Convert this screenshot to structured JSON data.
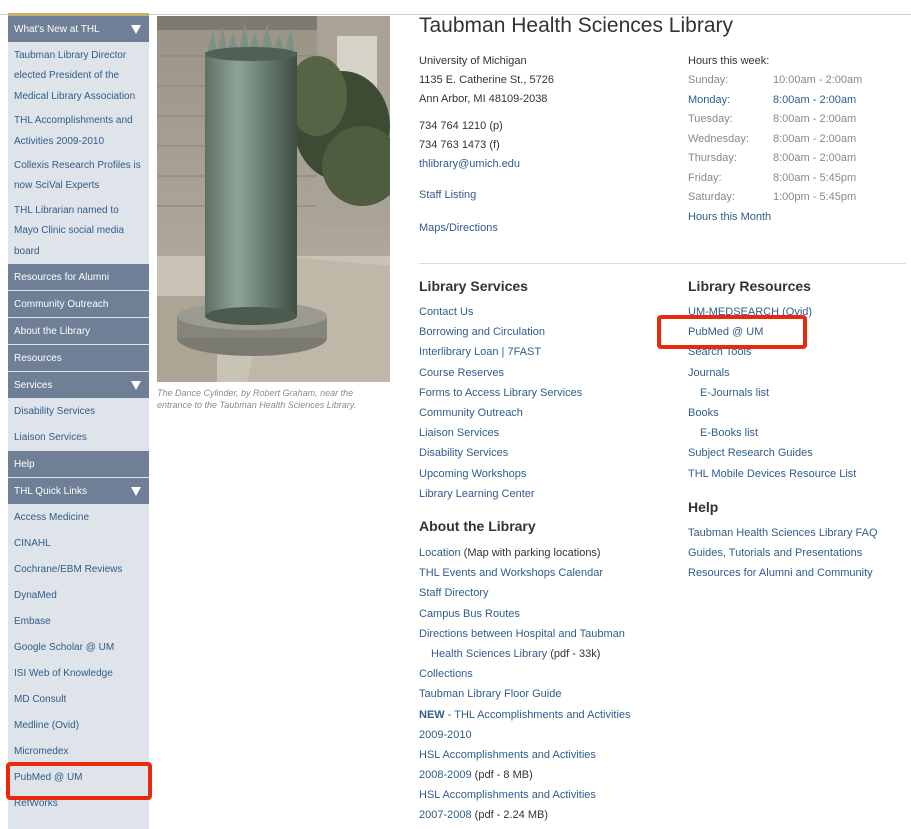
{
  "sidebar": {
    "whats_new": {
      "heading": "What's New at THL",
      "items": [
        "Taubman Library Director",
        "elected President of the",
        "Medical Library Association",
        "THL Accomplishments and",
        "Activities 2009-2010",
        "Collexis Research Profiles is",
        "now SciVal Experts",
        "THL Librarian named to",
        "Mayo Clinic social media",
        "board"
      ]
    },
    "plain_headings": [
      "Resources for Alumni",
      "Community Outreach",
      "About the Library",
      "Resources"
    ],
    "services": {
      "heading": "Services",
      "items": [
        "Disability Services",
        "Liaison Services"
      ]
    },
    "help": "Help",
    "quick_links": {
      "heading": "THL Quick Links",
      "items": [
        "Access Medicine",
        "CINAHL",
        "Cochrane/EBM Reviews",
        "DynaMed",
        "Embase",
        "Google Scholar @ UM",
        "ISI Web of Knowledge",
        "MD Consult",
        "Medline (Ovid)",
        "Micromedex",
        "PubMed @ UM",
        "RefWorks"
      ]
    }
  },
  "photo": {
    "caption_line1": "The Dance Cylinder, by Robert Graham, near the",
    "caption_line2": "entrance to the Taubman Health Sciences Library."
  },
  "header": {
    "title": "Taubman Health Sciences Library"
  },
  "contact": {
    "org": "University of Michigan",
    "street": "1135 E. Catherine St., 5726",
    "city": "Ann Arbor, MI 48109-2038",
    "phone": "734 764 1210 (p)",
    "fax": "734 763 1473 (f)",
    "email": "thlibrary@umich.edu",
    "staff_listing": "Staff Listing",
    "maps": "Maps/Directions"
  },
  "hours": {
    "heading": "Hours this week:",
    "days": [
      {
        "day": "Sunday:",
        "time": "10:00am - 2:00am"
      },
      {
        "day": "Monday:",
        "time": "8:00am - 2:00am"
      },
      {
        "day": "Tuesday:",
        "time": "8:00am - 2:00am"
      },
      {
        "day": "Wednesday:",
        "time": "8:00am - 2:00am"
      },
      {
        "day": "Thursday:",
        "time": "8:00am - 2:00am"
      },
      {
        "day": "Friday:",
        "time": "8:00am - 5:45pm"
      },
      {
        "day": "Saturday:",
        "time": "1:00pm - 5:45pm"
      }
    ],
    "month_link": "Hours this Month"
  },
  "library_services": {
    "heading": "Library Services",
    "items": [
      "Contact Us",
      "Borrowing and Circulation",
      "Interlibrary Loan | 7FAST",
      "Course Reserves",
      "Forms to Access Library Services",
      "Community Outreach",
      "Liaison Services",
      "Disability Services",
      "Upcoming Workshops",
      "Library Learning Center"
    ]
  },
  "about": {
    "heading": "About the Library",
    "location_link": "Location",
    "location_note": " (Map with parking locations)",
    "events": "THL Events and Workshops Calendar",
    "staff_dir": "Staff Directory",
    "bus": "Campus Bus Routes",
    "directions1": "Directions between Hospital and Taubman",
    "directions2": "Health Sciences Library",
    "directions_note": " (pdf - 33k)",
    "collections": "Collections",
    "floor_guide": "Taubman Library Floor Guide",
    "new_label": "NEW",
    "new_text": " - THL Accomplishments and Activities",
    "new_year": "2009-2010",
    "hsl1": "HSL Accomplishments and Activities",
    "hsl1_year": "2008-2009",
    "hsl1_note": " (pdf - 8 MB)",
    "hsl2": "HSL Accomplishments and Activities",
    "hsl2_year": "2007-2008",
    "hsl2_note": " (pdf - 2.24 MB)"
  },
  "library_resources": {
    "heading": "Library Resources",
    "medsearch": "UM-MEDSEARCH (Ovid)",
    "pubmed": "PubMed @ UM",
    "search_tools": "Search Tools",
    "journals": "Journals",
    "ejournals": "E-Journals list",
    "books": "Books",
    "ebooks": "E-Books list",
    "guides": "Subject Research Guides",
    "mobile": "THL Mobile Devices Resource List"
  },
  "help_section": {
    "heading": "Help",
    "items": [
      "Taubman Health Sciences Library FAQ",
      "Guides, Tutorials and Presentations",
      "Resources for Alumni and Community"
    ]
  },
  "colors": {
    "sidebar_head": "#6e7f96",
    "sidebar_bg": "#dfe3ea",
    "link": "#2f5d8c",
    "highlight": "#e8290b"
  }
}
